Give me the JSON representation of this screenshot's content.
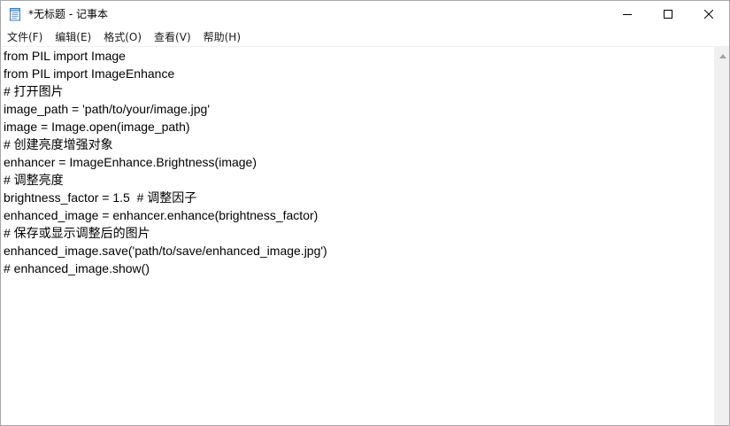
{
  "window": {
    "title": "*无标题 - 记事本"
  },
  "menu": {
    "items": [
      {
        "label": "文件(F)",
        "name": "menu-file"
      },
      {
        "label": "编辑(E)",
        "name": "menu-edit"
      },
      {
        "label": "格式(O)",
        "name": "menu-format"
      },
      {
        "label": "查看(V)",
        "name": "menu-view"
      },
      {
        "label": "帮助(H)",
        "name": "menu-help"
      }
    ]
  },
  "editor": {
    "lines": [
      "from PIL import Image",
      "from PIL import ImageEnhance",
      "# 打开图片",
      "image_path = 'path/to/your/image.jpg'",
      "image = Image.open(image_path)",
      "# 创建亮度增强对象",
      "enhancer = ImageEnhance.Brightness(image)",
      "# 调整亮度",
      "brightness_factor = 1.5  # 调整因子",
      "enhanced_image = enhancer.enhance(brightness_factor)",
      "# 保存或显示调整后的图片",
      "enhanced_image.save('path/to/save/enhanced_image.jpg')",
      "# enhanced_image.show()"
    ]
  },
  "icons": {
    "app": "notepad-icon",
    "minimize": "minimize-icon",
    "maximize": "maximize-icon",
    "close": "close-icon",
    "scroll_up": "scroll-up-arrow-icon"
  },
  "colors": {
    "background": "#ffffff",
    "scrollbar": "#f0f0f0",
    "border": "#a7a7a7",
    "text": "#000000"
  }
}
